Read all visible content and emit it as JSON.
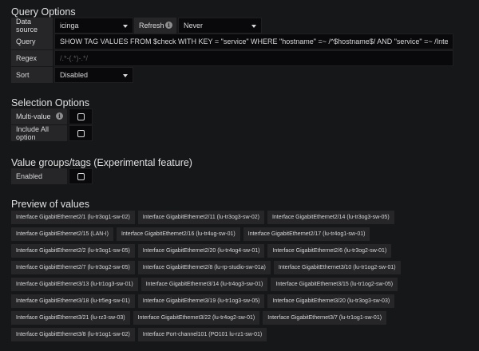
{
  "query_options": {
    "title": "Query Options",
    "data_source_label": "Data source",
    "data_source_value": "icinga",
    "refresh_label": "Refresh",
    "refresh_value": "Never",
    "query_label": "Query",
    "query_value": "SHOW TAG VALUES FROM $check WITH KEY = \"service\" WHERE \"hostname\" =~ /^$hostname$/ AND \"service\" =~ /Interface/",
    "regex_label": "Regex",
    "regex_placeholder": "/.*-(.*)-.*/",
    "sort_label": "Sort",
    "sort_value": "Disabled"
  },
  "selection_options": {
    "title": "Selection Options",
    "multi_value_label": "Multi-value",
    "include_all_label": "Include All option"
  },
  "value_groups": {
    "title": "Value groups/tags (Experimental feature)",
    "enabled_label": "Enabled"
  },
  "preview": {
    "title": "Preview of values",
    "values": [
      "Interface GigabitEthernet2/1 (lu-tr3og1-sw-02)",
      "Interface GigabitEthernet2/11 (lu-tr3og3-sw-02)",
      "Interface GigabitEthernet2/14 (lu-tr3og3-sw-05)",
      "Interface GigabitEthernet2/15 (LAN-I)",
      "Interface GigabitEthernet2/16 (lu-tr4ug-sw-01)",
      "Interface GigabitEthernet2/17 (lu-tr4og1-sw-01)",
      "Interface GigabitEthernet2/2 (lu-tr3og1-sw-05)",
      "Interface GigabitEthernet2/20 (lu-tr4og4-sw-01)",
      "Interface GigabitEthernet2/6 (lu-tr3og2-sw-01)",
      "Interface GigabitEthernet2/7 (lu-tr3og2-sw-05)",
      "Interface GigabitEthernet2/8 (lu-rp-studio-sw-01a)",
      "Interface GigabitEthernet3/10 (lu-tr1og2-sw-01)",
      "Interface GigabitEthernet3/13 (lu-tr1og3-sw-01)",
      "Interface GigabitEthernet3/14 (lu-tr4og3-sw-01)",
      "Interface GigabitEthernet3/15 (lu-tr1og2-sw-05)",
      "Interface GigabitEthernet3/18 (lu-tr5eg-sw-01)",
      "Interface GigabitEthernet3/19 (lu-tr1og3-sw-05)",
      "Interface GigabitEthernet3/20 (lu-tr3og3-sw-03)",
      "Interface GigabitEthernet3/21 (lu-rz3-sw-03)",
      "Interface GigabitEthernet3/22 (lu-tr4og2-sw-01)",
      "Interface GigabitEthernet3/7 (lu-tr1og1-sw-01)",
      "Interface GigabitEthernet3/8 (lu-tr1og1-sw-02)",
      "Interface Port-channel101 (PO101 lu-rz1-sw-01)"
    ]
  }
}
